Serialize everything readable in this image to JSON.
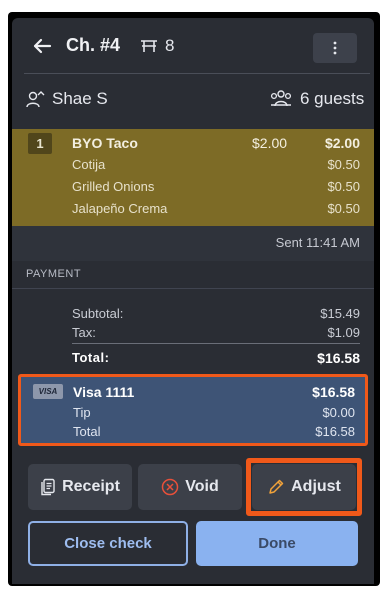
{
  "header": {
    "check_title": "Ch. #4",
    "table_number": "8"
  },
  "server": {
    "name": "Shae S",
    "guests": "6 guests"
  },
  "items": [
    {
      "qty": "1",
      "name": "BYO Taco",
      "price": "$2.00",
      "total": "$2.00",
      "modifiers": [
        {
          "name": "Cotija",
          "price": "$0.50"
        },
        {
          "name": "Grilled Onions",
          "price": "$0.50"
        },
        {
          "name": "Jalapeño Crema",
          "price": "$0.50"
        }
      ]
    }
  ],
  "sent": "Sent 11:41 AM",
  "payment": {
    "section_label": "PAYMENT",
    "subtotal_label": "Subtotal:",
    "subtotal": "$15.49",
    "tax_label": "Tax:",
    "tax": "$1.09",
    "total_label": "Total:",
    "total": "$16.58"
  },
  "card_payment": {
    "badge": "VISA",
    "name": "Visa 1111",
    "amount": "$16.58",
    "tip_label": "Tip",
    "tip": "$0.00",
    "total_label": "Total",
    "total": "$16.58"
  },
  "actions": {
    "receipt": "Receipt",
    "void": "Void",
    "adjust": "Adjust",
    "close_check": "Close check",
    "done": "Done"
  },
  "colors": {
    "item_bg": "#7d6b26",
    "card_bg": "#3e5476",
    "highlight": "#f0591a",
    "done_bg": "#8ab2f0"
  },
  "icons": [
    "back-arrow-icon",
    "table-icon",
    "more-vertical-icon",
    "server-icon",
    "guests-icon",
    "receipt-icon",
    "void-icon",
    "pencil-icon"
  ]
}
